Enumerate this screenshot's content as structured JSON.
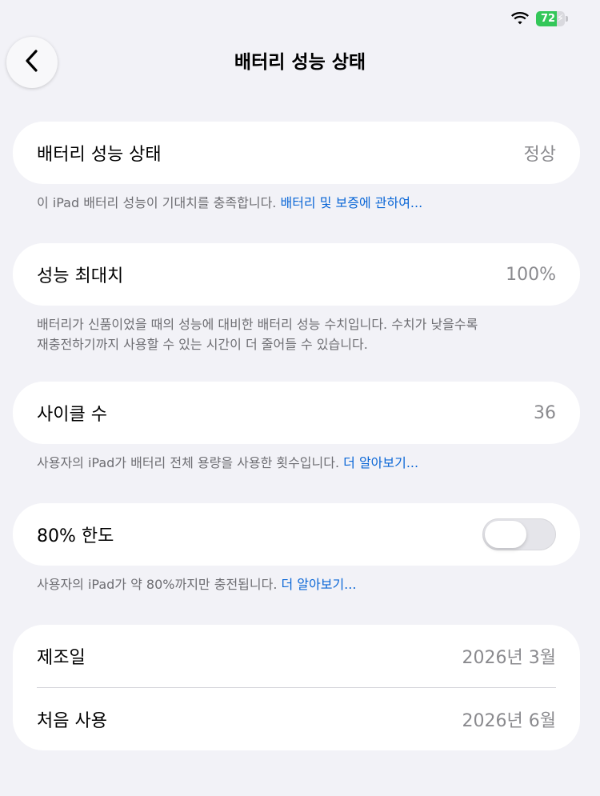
{
  "status": {
    "battery_percent": "72",
    "battery_level": 0.72,
    "battery_color": "#34c759"
  },
  "nav": {
    "back_icon": "chevron-left-icon",
    "title": "배터리 성능 상태"
  },
  "health": {
    "label": "배터리 성능 상태",
    "value": "정상",
    "footnote_text": "이 iPad 배터리 성능이 기대치를 충족합니다. ",
    "footnote_link": "배터리 및 보증에 관하여..."
  },
  "capacity": {
    "label": "성능 최대치",
    "value": "100%",
    "footnote_line1": "배터리가 신품이었을 때의 성능에 대비한 배터리 성능 수치입니다. 수치가 낮을수록",
    "footnote_line2": "재충전하기까지 사용할 수 있는 시간이 더 줄어들 수 있습니다."
  },
  "cycle": {
    "label": "사이클 수",
    "value": "36",
    "footnote_text": "사용자의 iPad가 배터리 전체 용량을 사용한 횟수입니다. ",
    "footnote_link": "더 알아보기..."
  },
  "limit": {
    "label": "80% 한도",
    "toggle_on": false,
    "footnote_text": "사용자의 iPad가 약 80%까지만 충전됩니다. ",
    "footnote_link": "더 알아보기..."
  },
  "dates": {
    "manufactured_label": "제조일",
    "manufactured_value": "2026년 3월",
    "first_use_label": "처음 사용",
    "first_use_value": "2026년 6월"
  }
}
